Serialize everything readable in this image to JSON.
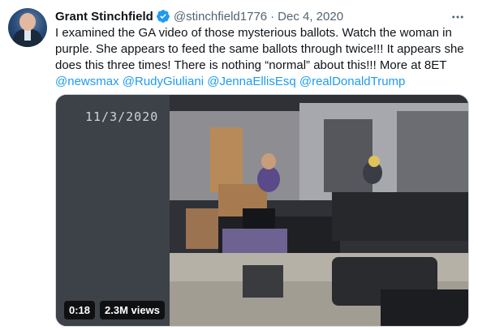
{
  "tweet": {
    "author_name": "Grant Stinchfield",
    "handle": "@stinchfield1776",
    "separator": "·",
    "date": "Dec 4, 2020",
    "text_lines": [
      "I examined the GA video of those mysterious ballots. Watch the woman in",
      "purple. She appears to feed the same ballots through twice!!! It appears she",
      "does this three times!  There is nothing “normal” about this!!! More at 8ET"
    ],
    "mentions": [
      "@newsmax",
      "@RudyGiuliani",
      "@JennaEllisEsq",
      "@realDonaldTrump"
    ]
  },
  "video": {
    "timestamp_overlay": "11/3/2020",
    "duration": "0:18",
    "views": "2.3M views"
  },
  "icons": {
    "verified": "verified-badge-icon",
    "more": "more-options-icon"
  },
  "colors": {
    "accent": "#1d9bf0",
    "text": "#0f1419",
    "secondary": "#536471"
  }
}
